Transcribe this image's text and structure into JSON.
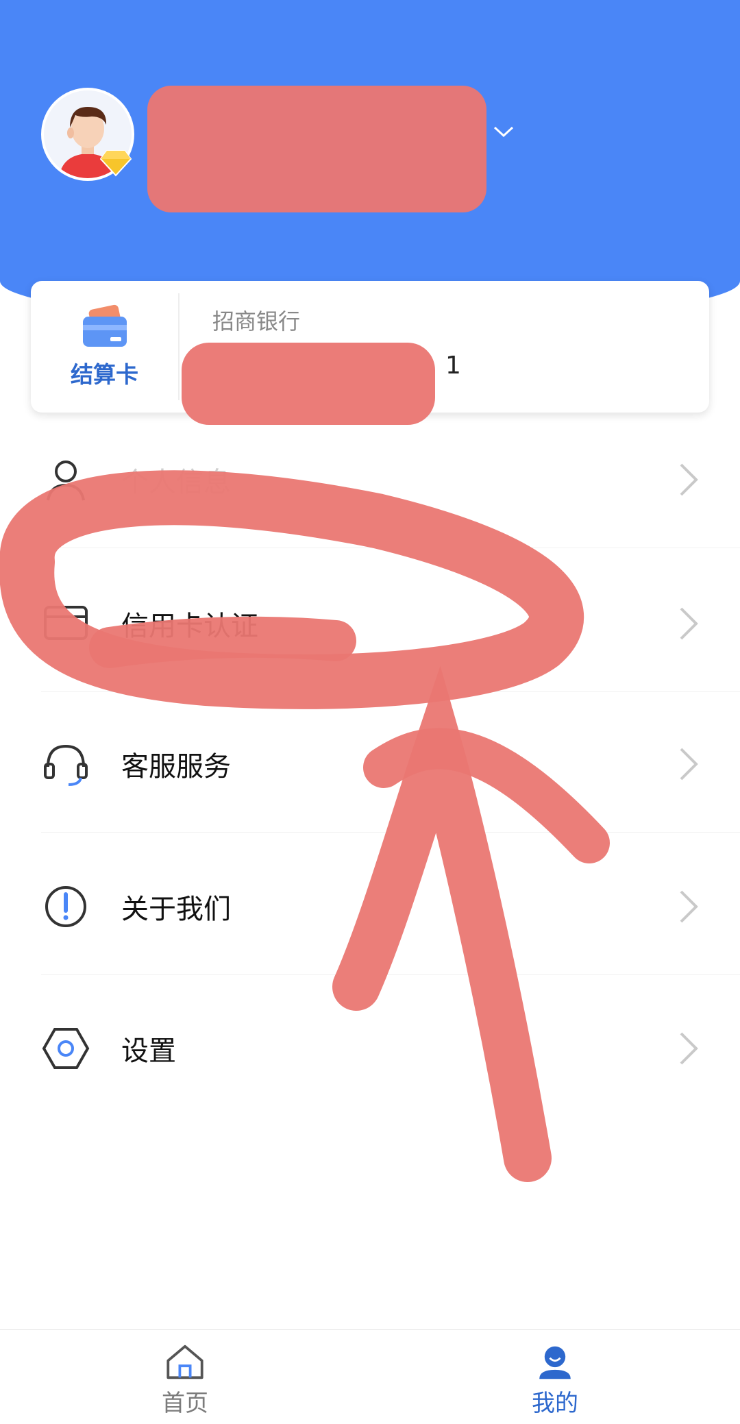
{
  "header": {
    "username": "",
    "colors": {
      "background": "#4a86f7"
    }
  },
  "card": {
    "type_label": "结算卡",
    "bank_name": "招商银行",
    "card_number_visible": "1",
    "icon": "card-icon"
  },
  "menu": [
    {
      "id": "personal-info",
      "label": "个人信息",
      "icon": "person-icon"
    },
    {
      "id": "credit-card-auth",
      "label": "信用卡认证",
      "icon": "card-outline-icon"
    },
    {
      "id": "customer-service",
      "label": "客服服务",
      "icon": "headset-icon"
    },
    {
      "id": "about-us",
      "label": "关于我们",
      "icon": "info-icon"
    },
    {
      "id": "settings",
      "label": "设置",
      "icon": "gear-icon"
    }
  ],
  "nav": [
    {
      "label": "首页",
      "icon": "home-icon",
      "active": false
    },
    {
      "label": "我的",
      "icon": "profile-icon",
      "active": true
    }
  ],
  "colors": {
    "accent": "#2d68cd",
    "inactive_nav": "#7b7b7b",
    "annotation": "#ea7772"
  }
}
